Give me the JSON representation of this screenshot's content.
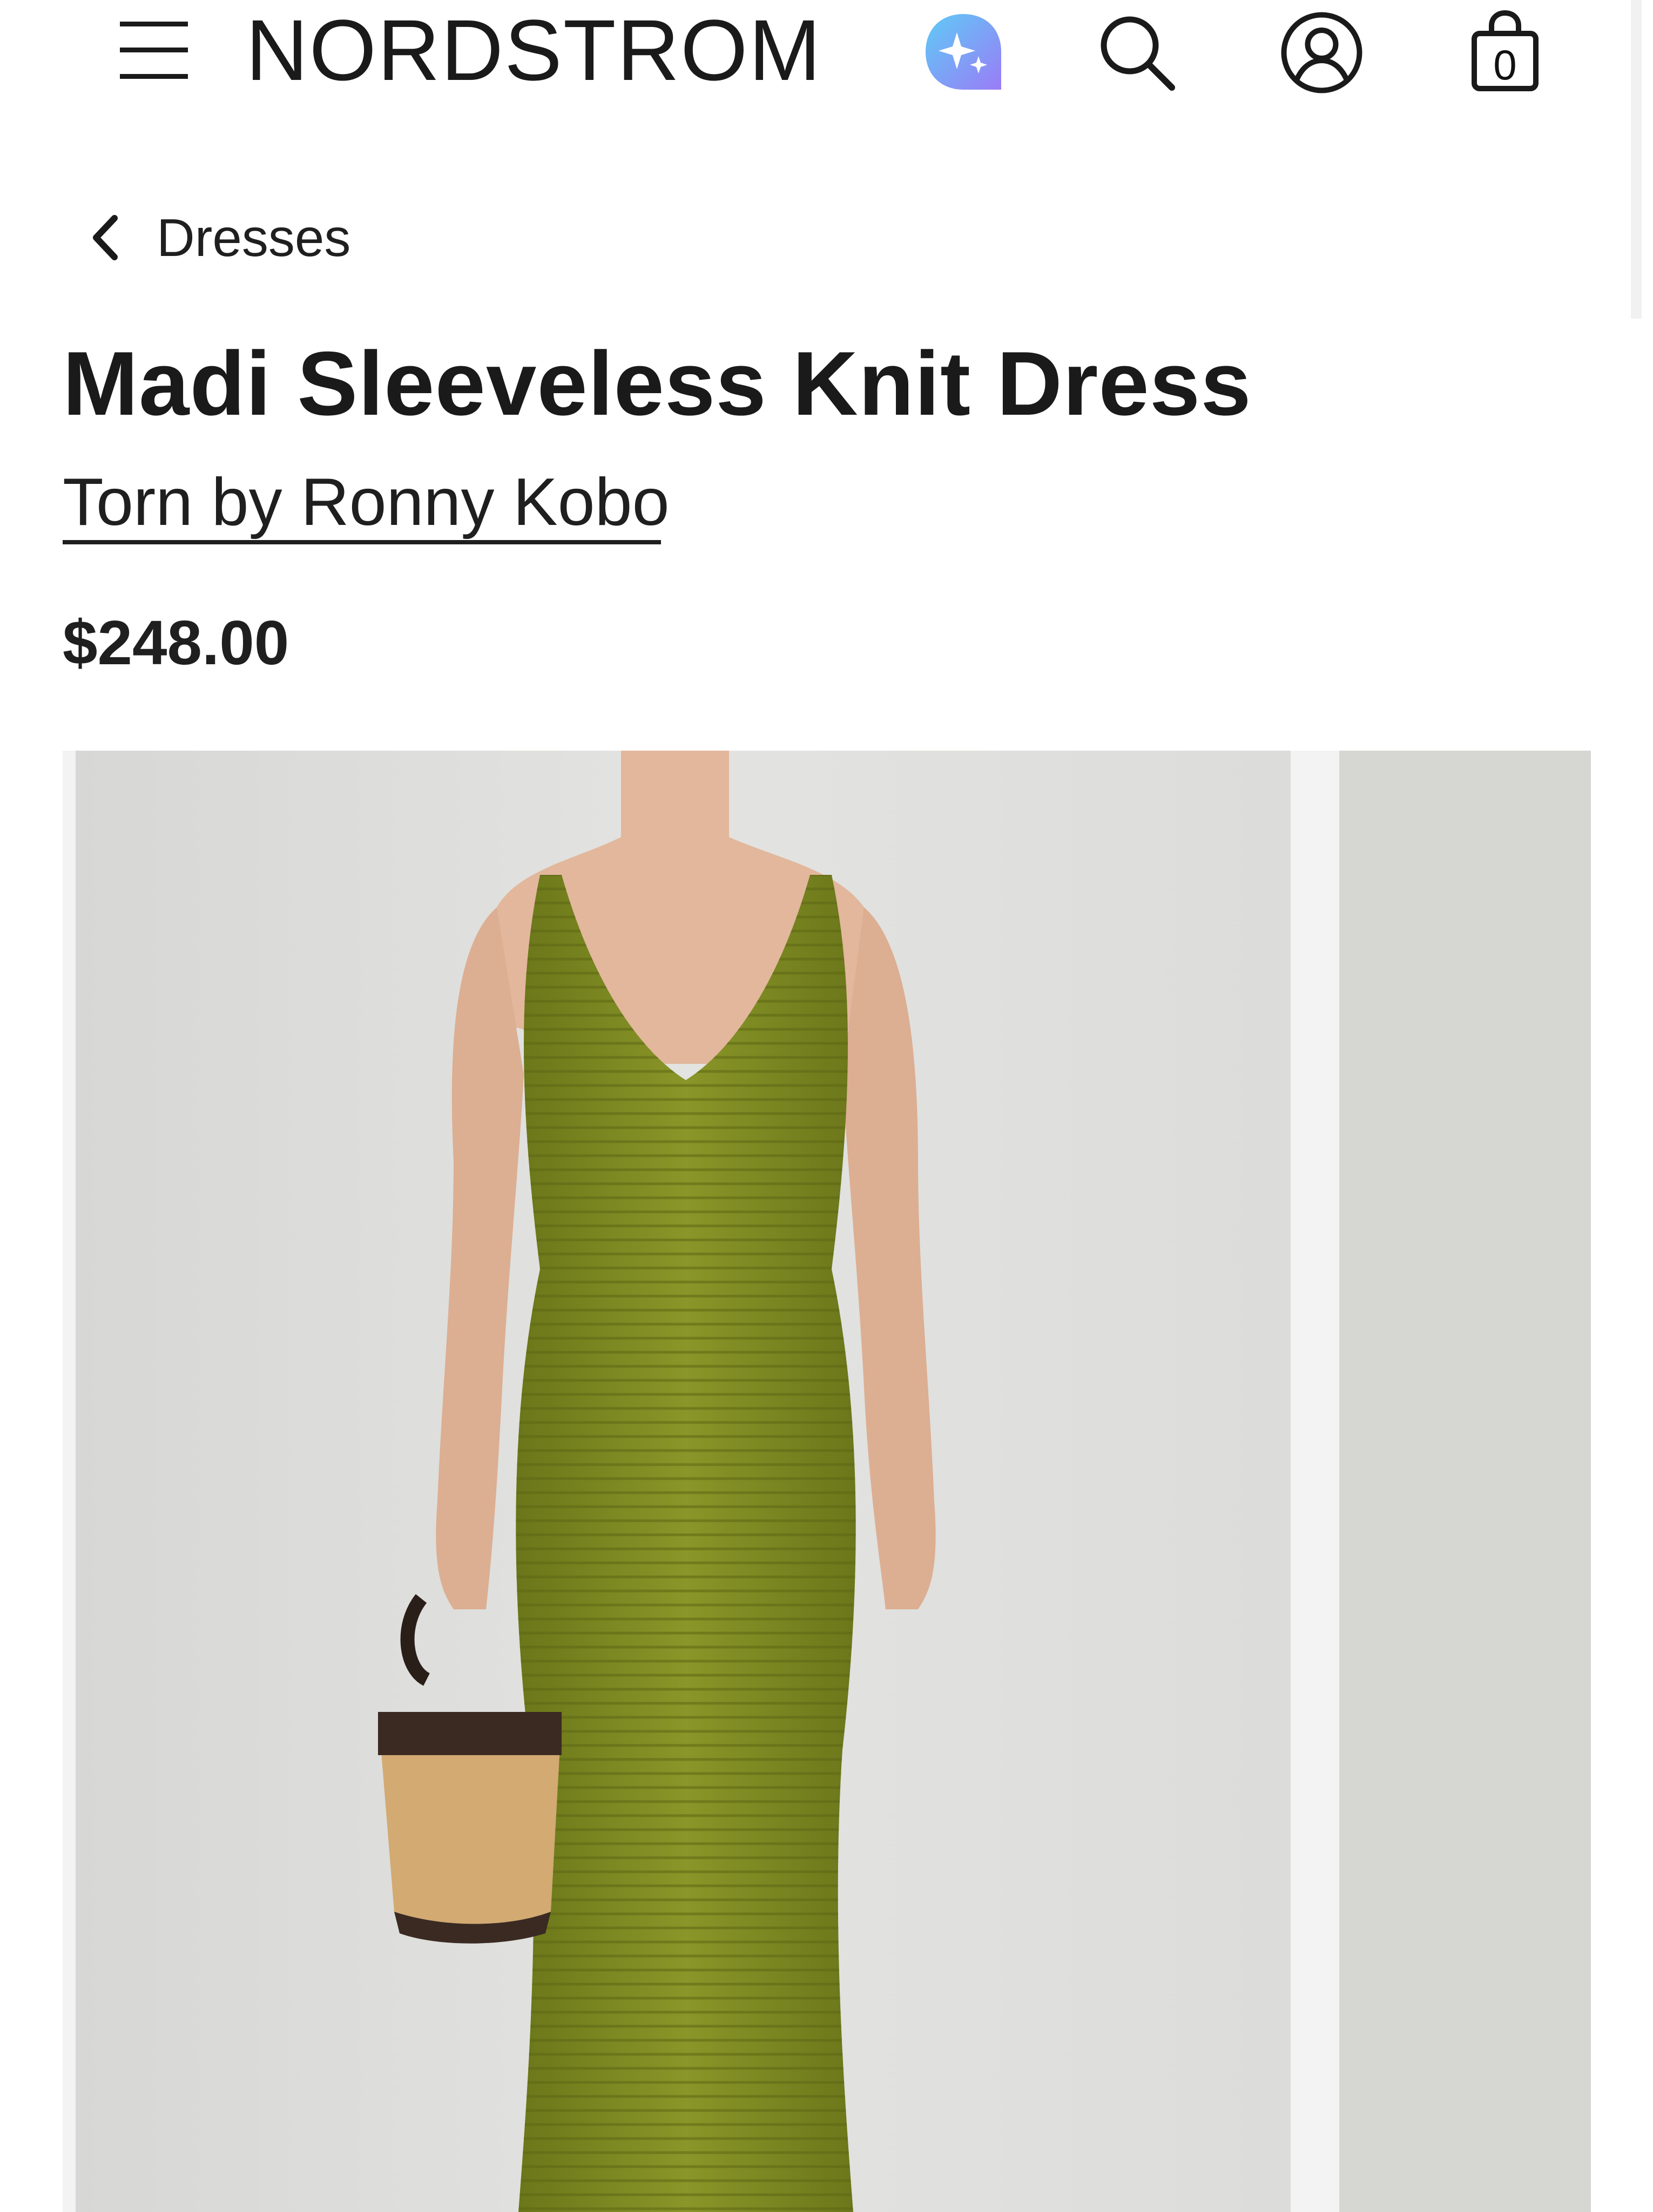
{
  "header": {
    "logo": "NORDSTROM",
    "bag_count": "0",
    "icons": [
      "menu-icon",
      "assistant-sparkle-icon",
      "search-icon",
      "account-icon",
      "shopping-bag-icon"
    ],
    "assistant_gradient": [
      "#5ecbf5",
      "#9a7cf7"
    ]
  },
  "breadcrumb": {
    "label": "Dresses"
  },
  "product": {
    "title": "Madi Sleeveless Knit Dress",
    "brand": "Torn by Ronny Kobo",
    "price": "$248.00"
  },
  "gallery": {
    "images": [
      {
        "description_icon": "product-photo"
      },
      {
        "description_icon": "product-photo-next"
      }
    ],
    "colors": {
      "background": "#dcdcdc",
      "dress": "#7d8a22"
    }
  }
}
